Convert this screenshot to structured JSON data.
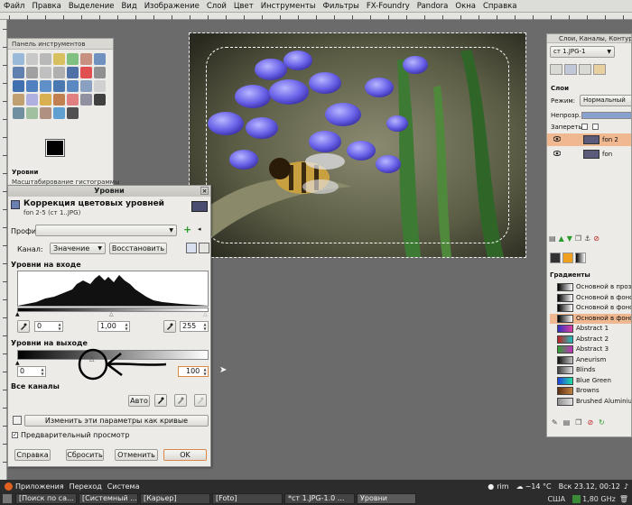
{
  "menubar": {
    "items": [
      "Файл",
      "Правка",
      "Выделение",
      "Вид",
      "Изображение",
      "Слой",
      "Цвет",
      "Инструменты",
      "Фильтры",
      "FX-Foundry",
      "Pandora",
      "Окна",
      "Справка"
    ]
  },
  "toolbox": {
    "title": "Панель инструментов",
    "options_title": "Уровни",
    "options_subtitle": "Масштабирование гистограммы"
  },
  "levels_dialog": {
    "window_title": "Уровни",
    "header_title": "Коррекция цветовых уровней",
    "header_subtitle": "fon 2-5 (ст 1..JPG)",
    "presets_label": "Профили:",
    "channel_label": "Канал:",
    "channel_value": "Значение",
    "reset_channel_button": "Восстановить",
    "input_levels_label": "Уровни на входе",
    "input_low": "0",
    "input_gamma": "1,00",
    "input_high": "255",
    "output_levels_label": "Уровни на выходе",
    "output_low": "0",
    "output_high": "100",
    "all_channels_label": "Все каналы",
    "auto_button": "Авто",
    "edit_curves_button": "Изменить эти параметры как кривые",
    "preview_label": "Предварительный просмотр",
    "help_button": "Справка",
    "reset_button": "Сбросить",
    "cancel_button": "Отменить",
    "ok_button": "OK"
  },
  "layers_panel": {
    "title": "Слои, Каналы, Контуры, Отмени",
    "image_selector": "ст 1.JPG-1",
    "section_title": "Слои",
    "mode_label": "Режим:",
    "mode_value": "Нормальный",
    "opacity_label": "Непрозр.:",
    "lock_label": "Запереть:",
    "layers": [
      {
        "name": "fon 2",
        "selected": true
      },
      {
        "name": "fon",
        "selected": false
      }
    ],
    "gradients_title": "Градиенты",
    "gradients": [
      {
        "name": "Основной в прозрачный",
        "colors": [
          "#000000",
          "#ffffff"
        ]
      },
      {
        "name": "Основной в фоновый (Жесткий)",
        "colors": [
          "#000000",
          "#ffffff"
        ]
      },
      {
        "name": "Основной в фоновый (HSV)",
        "colors": [
          "#000000",
          "#ffffff"
        ]
      },
      {
        "name": "Основной в фоновый (RGB)",
        "colors": [
          "#000000",
          "#ffffff"
        ],
        "selected": true
      },
      {
        "name": "Abstract 1",
        "colors": [
          "#3030c0",
          "#e040a0"
        ]
      },
      {
        "name": "Abstract 2",
        "colors": [
          "#c02020",
          "#20c0c0"
        ]
      },
      {
        "name": "Abstract 3",
        "colors": [
          "#30a030",
          "#c030c0"
        ]
      },
      {
        "name": "Aneurism",
        "colors": [
          "#101010",
          "#c0c0c0"
        ]
      },
      {
        "name": "Blinds",
        "colors": [
          "#404040",
          "#e0e0e0"
        ]
      },
      {
        "name": "Blue Green",
        "colors": [
          "#2040e0",
          "#20e0a0"
        ]
      },
      {
        "name": "Browns",
        "colors": [
          "#603010",
          "#c08040"
        ]
      },
      {
        "name": "Brushed Aluminium",
        "colors": [
          "#909090",
          "#e0e0e0"
        ]
      }
    ]
  },
  "taskbar": {
    "apps_menu": "Приложения",
    "places_menu": "Переход",
    "system_menu": "Система",
    "user": "rim",
    "weather": "−14 °C",
    "clock": "Вск 23.12, 00:12",
    "keyboard": "США",
    "cpu": "1,80 GHz",
    "tasks": [
      "[Поиск по са...",
      "[Системный ...",
      "[Карьер]",
      "[Foto]",
      "*ст 1.JPG-1.0 ...",
      "Уровни"
    ],
    "active_task": "Уровни"
  }
}
